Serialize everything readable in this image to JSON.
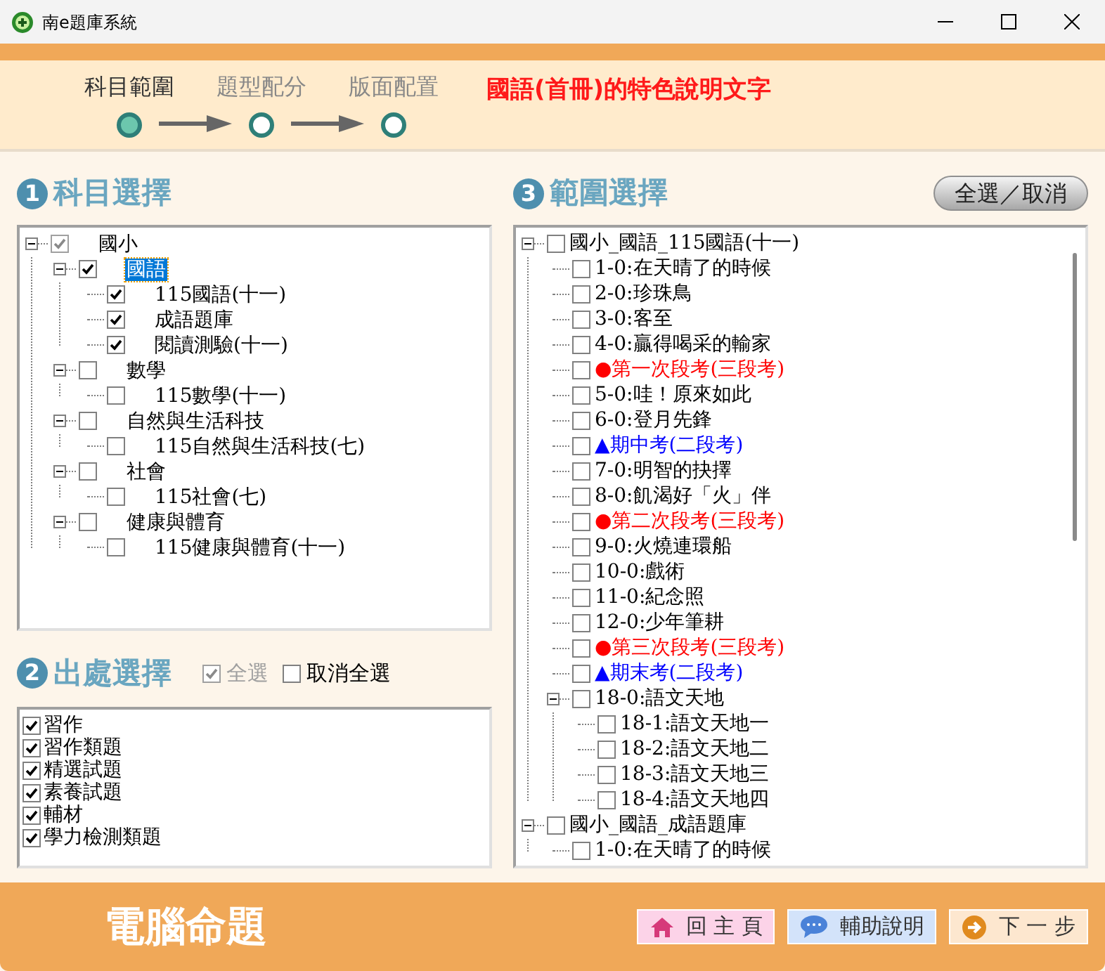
{
  "window": {
    "title": "南e題庫系統"
  },
  "steps": [
    {
      "label": "科目範圍",
      "selected": true
    },
    {
      "label": "題型配分",
      "selected": false
    },
    {
      "label": "版面配置",
      "selected": false
    }
  ],
  "feature_text": "國語(首冊)的特色說明文字",
  "subject_section": {
    "number": "1",
    "title": "科目選擇",
    "tree": [
      {
        "label": "國小",
        "checked": true,
        "indeterminate": true,
        "selected": false,
        "expanded": true,
        "children": [
          {
            "label": "國語",
            "checked": true,
            "selected": true,
            "expanded": true,
            "children": [
              {
                "label": "115國語(十一)",
                "checked": true,
                "selected": false
              },
              {
                "label": "成語題庫",
                "checked": true,
                "selected": false
              },
              {
                "label": "閱讀測驗(十一)",
                "checked": true,
                "selected": false
              }
            ]
          },
          {
            "label": "數學",
            "checked": false,
            "selected": false,
            "expanded": true,
            "children": [
              {
                "label": "115數學(十一)",
                "checked": false,
                "selected": false
              }
            ]
          },
          {
            "label": "自然與生活科技",
            "checked": false,
            "selected": false,
            "expanded": true,
            "children": [
              {
                "label": "115自然與生活科技(七)",
                "checked": false,
                "selected": false
              }
            ]
          },
          {
            "label": "社會",
            "checked": false,
            "selected": false,
            "expanded": true,
            "children": [
              {
                "label": "115社會(七)",
                "checked": false,
                "selected": false
              }
            ]
          },
          {
            "label": "健康與體育",
            "checked": false,
            "selected": false,
            "expanded": true,
            "children": [
              {
                "label": "115健康與體育(十一)",
                "checked": false,
                "selected": false
              }
            ]
          }
        ]
      }
    ]
  },
  "source_section": {
    "number": "2",
    "title": "出處選擇",
    "select_all": {
      "label": "全選",
      "checked": true,
      "disabled": true
    },
    "deselect_all": {
      "label": "取消全選",
      "checked": false,
      "disabled": false
    },
    "items": [
      {
        "label": "習作",
        "checked": true
      },
      {
        "label": "習作類題",
        "checked": true
      },
      {
        "label": "精選試題",
        "checked": true
      },
      {
        "label": "素養試題",
        "checked": true
      },
      {
        "label": "輔材",
        "checked": true
      },
      {
        "label": "學力檢測類題",
        "checked": true
      }
    ]
  },
  "range_section": {
    "number": "3",
    "title": "範圍選擇",
    "toggle_button": "全選／取消",
    "tree": [
      {
        "kind": "lesson",
        "label": "國小_國語_115國語(十一)",
        "checked": false,
        "expanded": true,
        "children": [
          {
            "kind": "lesson",
            "label": "1-0:在天晴了的時候",
            "checked": false
          },
          {
            "kind": "lesson",
            "label": "2-0:珍珠鳥",
            "checked": false
          },
          {
            "kind": "lesson",
            "label": "3-0:客至",
            "checked": false
          },
          {
            "kind": "lesson",
            "label": "4-0:贏得喝采的輸家",
            "checked": false
          },
          {
            "kind": "exam",
            "marker": "●",
            "label": "第一次段考(三段考)",
            "color": "#ff0000",
            "checked": false
          },
          {
            "kind": "lesson",
            "label": "5-0:哇！原來如此",
            "checked": false
          },
          {
            "kind": "lesson",
            "label": "6-0:登月先鋒",
            "checked": false
          },
          {
            "kind": "exam",
            "marker": "▲",
            "label": "期中考(二段考)",
            "color": "#0000ff",
            "checked": false
          },
          {
            "kind": "lesson",
            "label": "7-0:明智的抉擇",
            "checked": false
          },
          {
            "kind": "lesson",
            "label": "8-0:飢渴好「火」伴",
            "checked": false
          },
          {
            "kind": "exam",
            "marker": "●",
            "label": "第二次段考(三段考)",
            "color": "#ff0000",
            "checked": false
          },
          {
            "kind": "lesson",
            "label": "9-0:火燒連環船",
            "checked": false
          },
          {
            "kind": "lesson",
            "label": "10-0:戲術",
            "checked": false
          },
          {
            "kind": "lesson",
            "label": "11-0:紀念照",
            "checked": false
          },
          {
            "kind": "lesson",
            "label": "12-0:少年筆耕",
            "checked": false
          },
          {
            "kind": "exam",
            "marker": "●",
            "label": "第三次段考(三段考)",
            "color": "#ff0000",
            "checked": false
          },
          {
            "kind": "exam",
            "marker": "▲",
            "label": "期末考(二段考)",
            "color": "#0000ff",
            "checked": false
          },
          {
            "kind": "lesson",
            "label": "18-0:語文天地",
            "checked": false,
            "expanded": true,
            "children": [
              {
                "kind": "lesson",
                "label": "18-1:語文天地一",
                "checked": false
              },
              {
                "kind": "lesson",
                "label": "18-2:語文天地二",
                "checked": false
              },
              {
                "kind": "lesson",
                "label": "18-3:語文天地三",
                "checked": false
              },
              {
                "kind": "lesson",
                "label": "18-4:語文天地四",
                "checked": false
              }
            ]
          }
        ]
      },
      {
        "kind": "lesson",
        "label": "國小_國語_成語題庫",
        "checked": false,
        "expanded": true,
        "children": [
          {
            "kind": "lesson",
            "label": "1-0:在天晴了的時候",
            "checked": false
          }
        ]
      }
    ]
  },
  "footer": {
    "title": "電腦命題",
    "buttons": [
      {
        "kind": "home",
        "label": "回 主 頁"
      },
      {
        "kind": "help",
        "label": "輔助說明"
      },
      {
        "kind": "next",
        "label": "下 一 步"
      }
    ]
  }
}
